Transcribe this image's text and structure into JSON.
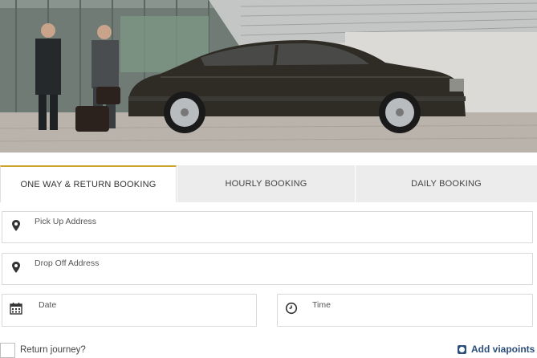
{
  "hero": {
    "image": "executive-car-photo"
  },
  "tabs": [
    {
      "label": "ONE WAY & RETURN BOOKING",
      "active": true
    },
    {
      "label": "HOURLY BOOKING",
      "active": false
    },
    {
      "label": "DAILY BOOKING",
      "active": false
    }
  ],
  "form": {
    "pickup": {
      "label": "Pick Up Address",
      "icon": "map-pin-icon"
    },
    "dropoff": {
      "label": "Drop Off Address",
      "icon": "map-pin-icon"
    },
    "date": {
      "label": "Date",
      "icon": "calendar-icon"
    },
    "time": {
      "label": "Time",
      "icon": "clock-icon"
    }
  },
  "footer": {
    "return_label": "Return journey?",
    "add_viapoints_label": "Add viapoints"
  },
  "colors": {
    "accent": "#c9a227",
    "link": "#2b4f7a",
    "tab_inactive": "#ececec"
  }
}
